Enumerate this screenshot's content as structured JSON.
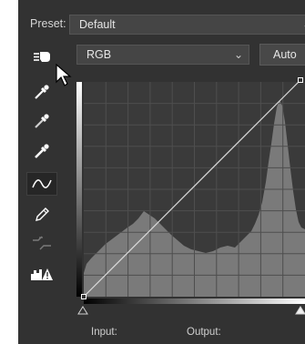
{
  "preset": {
    "label": "Preset:",
    "value": "Default"
  },
  "channel": {
    "value": "RGB"
  },
  "auto_button": {
    "label": "Auto"
  },
  "tools": [
    "on-image-adjust-icon",
    "black-point-eyedropper-icon",
    "gray-point-eyedropper-icon",
    "white-point-eyedropper-icon",
    "curve-point-edit-icon",
    "pencil-draw-icon",
    "smooth-curve-icon",
    "clipping-warning-icon"
  ],
  "footer": {
    "input_label": "Input:",
    "output_label": "Output:"
  },
  "colors": {
    "panel_bg": "#323232",
    "graph_bg": "#3a3a3a",
    "histogram": "#7a7a7a",
    "grid": "#4e4e4e"
  }
}
